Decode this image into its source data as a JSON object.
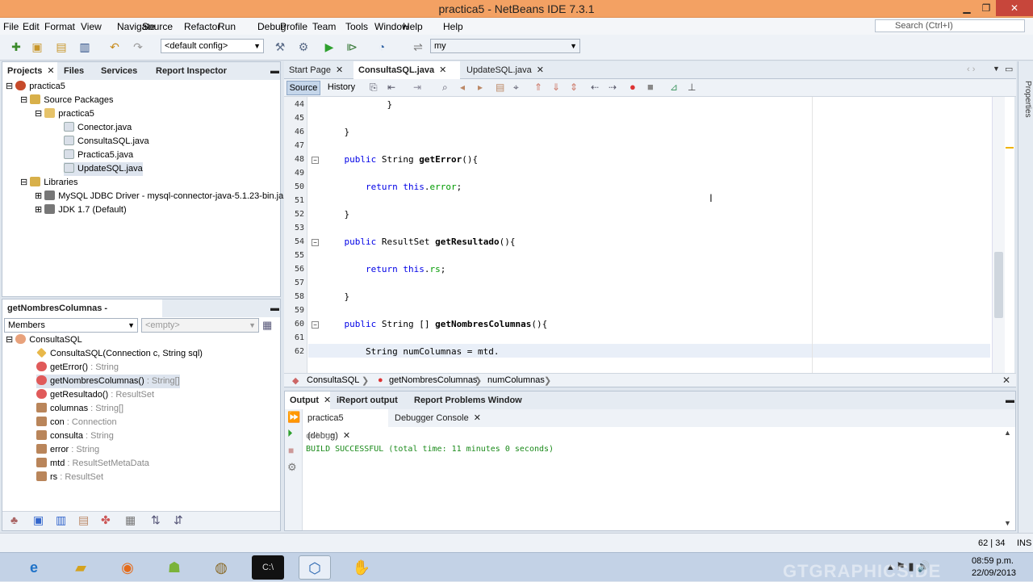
{
  "window": {
    "title": "practica5 - NetBeans IDE 7.3.1",
    "min": "▁",
    "max": "❐",
    "close": "✕"
  },
  "menu": [
    "File",
    "Edit",
    "Format",
    "View",
    "Navigate",
    "Source",
    "Refactor",
    "Run",
    "Debug",
    "Profile",
    "Team",
    "Tools",
    "Window",
    "Help"
  ],
  "search": {
    "placeholder": "Search (Ctrl+I)"
  },
  "toolbar": {
    "config": "<default config>",
    "target": "my"
  },
  "projects": {
    "tabs": [
      "Projects",
      "Files",
      "Services",
      "Report Inspector"
    ],
    "tree": [
      {
        "label": "practica5",
        "depth": 0,
        "icon": "project-icon"
      },
      {
        "label": "Source Packages",
        "depth": 1,
        "icon": "folder-icon"
      },
      {
        "label": "practica5",
        "depth": 2,
        "icon": "package-icon"
      },
      {
        "label": "Conector.java",
        "depth": 3,
        "icon": "java-file-icon"
      },
      {
        "label": "ConsultaSQL.java",
        "depth": 3,
        "icon": "java-file-icon"
      },
      {
        "label": "Practica5.java",
        "depth": 3,
        "icon": "java-file-icon"
      },
      {
        "label": "UpdateSQL.java",
        "depth": 3,
        "icon": "java-file-icon",
        "selected": true
      },
      {
        "label": "Libraries",
        "depth": 1,
        "icon": "library-icon"
      },
      {
        "label": "MySQL JDBC Driver - mysql-connector-java-5.1.23-bin.jar",
        "depth": 2,
        "icon": "jar-icon"
      },
      {
        "label": "JDK 1.7 (Default)",
        "depth": 2,
        "icon": "jdk-icon"
      }
    ]
  },
  "navigator": {
    "title": "getNombresColumnas - Navigator",
    "members": "Members",
    "filter": "<empty>",
    "root": "ConsultaSQL",
    "items": [
      {
        "name": "ConsultaSQL(Connection c, String sql)",
        "type": "",
        "kind": "constructor"
      },
      {
        "name": "getError()",
        "type": " : String",
        "kind": "method"
      },
      {
        "name": "getNombresColumnas()",
        "type": " : String[]",
        "kind": "method",
        "selected": true
      },
      {
        "name": "getResultado()",
        "type": " : ResultSet",
        "kind": "method"
      },
      {
        "name": "columnas",
        "type": " : String[]",
        "kind": "field"
      },
      {
        "name": "con",
        "type": " : Connection",
        "kind": "field"
      },
      {
        "name": "consulta",
        "type": " : String",
        "kind": "field"
      },
      {
        "name": "error",
        "type": " : String",
        "kind": "field"
      },
      {
        "name": "mtd",
        "type": " : ResultSetMetaData",
        "kind": "field"
      },
      {
        "name": "rs",
        "type": " : ResultSet",
        "kind": "field"
      }
    ]
  },
  "editor": {
    "tabs": [
      "Start Page",
      "ConsultaSQL.java",
      "UpdateSQL.java"
    ],
    "active": 1,
    "subtabs": [
      "Source",
      "History"
    ],
    "lines": [
      {
        "n": "44",
        "t": "            }"
      },
      {
        "n": "45",
        "t": ""
      },
      {
        "n": "46",
        "t": "    }"
      },
      {
        "n": "47",
        "t": ""
      },
      {
        "n": "48",
        "t": "    public String getError(){"
      },
      {
        "n": "49",
        "t": ""
      },
      {
        "n": "50",
        "t": "        return this.error;"
      },
      {
        "n": "51",
        "t": ""
      },
      {
        "n": "52",
        "t": "    }"
      },
      {
        "n": "53",
        "t": ""
      },
      {
        "n": "54",
        "t": "    public ResultSet getResultado(){"
      },
      {
        "n": "55",
        "t": ""
      },
      {
        "n": "56",
        "t": "        return this.rs;"
      },
      {
        "n": "57",
        "t": ""
      },
      {
        "n": "58",
        "t": "    }"
      },
      {
        "n": "59",
        "t": ""
      },
      {
        "n": "60",
        "t": "    public String [] getNombresColumnas(){"
      },
      {
        "n": "61",
        "t": ""
      },
      {
        "n": "62",
        "t": "        String numColumnas = mtd."
      }
    ],
    "breadcrumb": [
      "ConsultaSQL",
      "getNombresColumnas",
      "numColumnas"
    ]
  },
  "output": {
    "tabs": [
      "Output",
      "iReport output",
      "Report Problems Window"
    ],
    "subtabs": [
      "practica5 (debug)",
      "Debugger Console"
    ],
    "line1": "debug:",
    "line2": "BUILD SUCCESSFUL (total time: 11 minutes 0 seconds)"
  },
  "status": {
    "position": "62 | 34",
    "mode": "INS"
  },
  "taskbar": {
    "time": "08:59 p.m.",
    "date": "22/09/2013",
    "watermark": "GTGRAPHICS.DE"
  },
  "colors": {
    "titlebar": "#f3a163",
    "keyword": "#0000e6",
    "field": "#009a00"
  }
}
